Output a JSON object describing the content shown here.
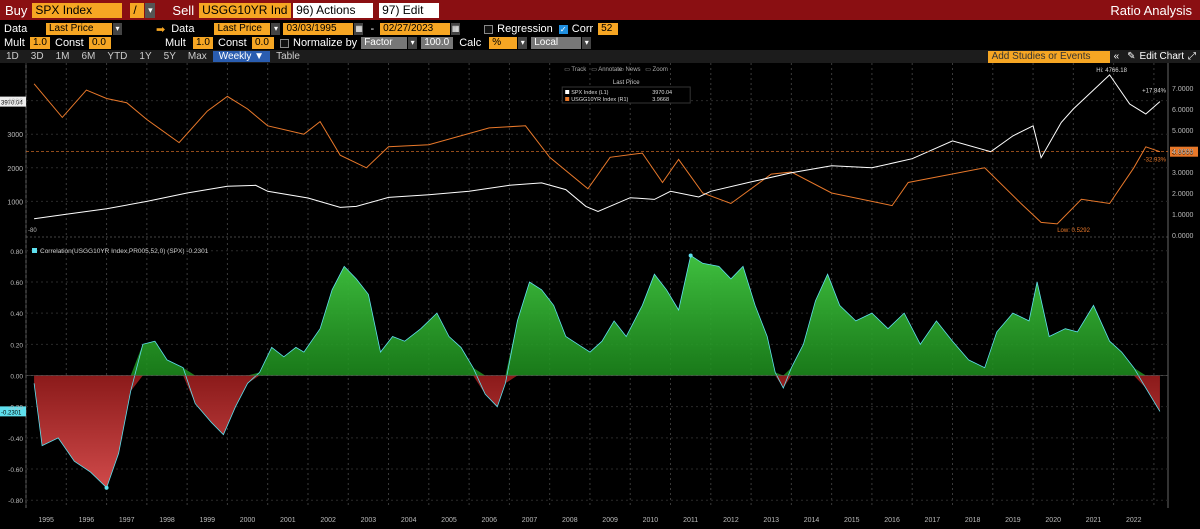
{
  "topbar": {
    "buy": "Buy",
    "security1": "SPX Index",
    "slash": "/",
    "sell": "Sell",
    "security2": "USGG10YR Ind",
    "actions": "96) Actions",
    "edit": "97) Edit",
    "title": "Ratio Analysis"
  },
  "row1": {
    "data_label": "Data",
    "data_value": "Last Price",
    "data2_label": "Data",
    "data2_value": "Last Price",
    "date_from": "03/03/1995",
    "dash": "-",
    "date_to": "02/27/2023",
    "regression": "Regression",
    "corr": "Corr",
    "corr_value": "52"
  },
  "row2": {
    "mult": "Mult",
    "mult_value": "1.0",
    "const": "Const",
    "const_value": "0.0",
    "mult2": "Mult",
    "mult2_value": "1.0",
    "const2": "Const",
    "const2_value": "0.0",
    "normalize": "Normalize by",
    "normalize_value": "Factor",
    "factor_value": "100.0",
    "calc": "Calc",
    "calc_value": "%",
    "ccy": "Local CCY"
  },
  "tabs": [
    "1D",
    "3D",
    "1M",
    "6M",
    "YTD",
    "1Y",
    "5Y",
    "Max",
    "Weekly ▼",
    "Table"
  ],
  "tab_active": 8,
  "toolbar": {
    "add_studies": "Add Studies or Events",
    "edit_chart": "Edit Chart"
  },
  "colors": {
    "spx": "#ffffff",
    "yield": "#e8782a",
    "corr_pos": "#1e8f1e",
    "corr_neg": "#8b1a1a",
    "corr_line": "#5fe0ee",
    "topbar": "#8a0f12",
    "accent": "#f6a623"
  },
  "chart_data": [
    {
      "type": "line",
      "legend": {
        "title": "Last Price",
        "items": [
          {
            "name": "SPX Index (L1)",
            "value": "3970.04"
          },
          {
            "name": "USGG10YR Index (R1)",
            "value": "3.9668"
          }
        ],
        "tools": [
          "Track",
          "Annotate",
          "News",
          "Zoom"
        ]
      },
      "x_years": [
        1995,
        1996,
        1997,
        1998,
        1999,
        2000,
        2001,
        2002,
        2003,
        2004,
        2005,
        2006,
        2007,
        2008,
        2009,
        2010,
        2011,
        2012,
        2013,
        2014,
        2015,
        2016,
        2017,
        2018,
        2019,
        2020,
        2021,
        2022,
        2023
      ],
      "left_axis": {
        "ticks": [
          "1000",
          "2000",
          "3000",
          "4000"
        ],
        "ylim": [
          0,
          5000
        ]
      },
      "right_axis": {
        "ticks": [
          "0.0000",
          "1.0000",
          "2.0000",
          "3.0000",
          "4.0000",
          "5.0000",
          "6.0000",
          "7.0000"
        ],
        "ylim": [
          0,
          8
        ]
      },
      "series": [
        {
          "name": "SPX Index",
          "axis": "left",
          "points": [
            [
              1995.2,
              485
            ],
            [
              1996,
              620
            ],
            [
              1997,
              780
            ],
            [
              1998,
              1000
            ],
            [
              1999,
              1250
            ],
            [
              2000,
              1450
            ],
            [
              2000.7,
              1480
            ],
            [
              2001,
              1300
            ],
            [
              2002,
              1100
            ],
            [
              2002.8,
              820
            ],
            [
              2003.2,
              850
            ],
            [
              2004,
              1120
            ],
            [
              2005,
              1200
            ],
            [
              2006,
              1300
            ],
            [
              2007,
              1480
            ],
            [
              2007.8,
              1550
            ],
            [
              2008.4,
              1350
            ],
            [
              2008.9,
              850
            ],
            [
              2009.2,
              700
            ],
            [
              2010,
              1110
            ],
            [
              2010.6,
              1060
            ],
            [
              2011,
              1300
            ],
            [
              2011.7,
              1130
            ],
            [
              2012,
              1300
            ],
            [
              2013,
              1580
            ],
            [
              2014,
              1850
            ],
            [
              2015,
              2060
            ],
            [
              2016,
              2000
            ],
            [
              2017,
              2270
            ],
            [
              2018,
              2800
            ],
            [
              2018.95,
              2480
            ],
            [
              2019.5,
              2950
            ],
            [
              2020,
              3250
            ],
            [
              2020.2,
              2300
            ],
            [
              2020.7,
              3350
            ],
            [
              2021,
              3750
            ],
            [
              2021.9,
              4766
            ],
            [
              2022.4,
              3900
            ],
            [
              2022.8,
              3600
            ],
            [
              2023.15,
              3970
            ]
          ]
        },
        {
          "name": "USGG10YR Index",
          "axis": "right",
          "points": [
            [
              1995.2,
              7.2
            ],
            [
              1995.9,
              5.6
            ],
            [
              1996.5,
              6.9
            ],
            [
              1997,
              6.5
            ],
            [
              1997.5,
              6.3
            ],
            [
              1998,
              5.5
            ],
            [
              1998.8,
              4.4
            ],
            [
              1999.5,
              5.9
            ],
            [
              2000,
              6.6
            ],
            [
              2000.5,
              6.0
            ],
            [
              2001,
              5.2
            ],
            [
              2001.9,
              4.8
            ],
            [
              2002.3,
              5.4
            ],
            [
              2002.8,
              3.8
            ],
            [
              2003.45,
              3.2
            ],
            [
              2004,
              4.2
            ],
            [
              2005,
              4.3
            ],
            [
              2006.5,
              5.1
            ],
            [
              2007.4,
              5.2
            ],
            [
              2008,
              3.7
            ],
            [
              2008.95,
              2.2
            ],
            [
              2009.5,
              3.7
            ],
            [
              2010.3,
              3.9
            ],
            [
              2010.8,
              2.5
            ],
            [
              2011.2,
              3.6
            ],
            [
              2011.8,
              2.0
            ],
            [
              2012.5,
              1.5
            ],
            [
              2013.5,
              2.9
            ],
            [
              2014,
              3.0
            ],
            [
              2015,
              2.0
            ],
            [
              2016.5,
              1.4
            ],
            [
              2016.9,
              2.5
            ],
            [
              2018.8,
              3.2
            ],
            [
              2019.7,
              1.5
            ],
            [
              2020.2,
              0.6
            ],
            [
              2020.6,
              0.53
            ],
            [
              2021.2,
              1.7
            ],
            [
              2021.9,
              1.5
            ],
            [
              2022.5,
              3.2
            ],
            [
              2022.8,
              4.2
            ],
            [
              2023.15,
              3.9668
            ]
          ]
        }
      ],
      "annotations": {
        "high": "Hi: 4766.18",
        "low": "Low: 0.5292",
        "spx_last": "3970.04",
        "yield_last": "3.9668",
        "spx_pct": "+17.84%",
        "yield_pct": "-32.93%",
        "bottom_tag": "-80"
      }
    },
    {
      "type": "area",
      "title": "Correlation(USGG10YR Index,PR005,52,0) (SPX) -0.2301",
      "last_value": "-0.2301",
      "y_ticks": [
        "-0.80",
        "-0.60",
        "-0.40",
        "-0.20",
        "0.00",
        "0.20",
        "0.40",
        "0.60",
        "0.80"
      ],
      "ylim": [
        -0.85,
        0.85
      ],
      "x_years": [
        1995,
        1996,
        1997,
        1998,
        1999,
        2000,
        2001,
        2002,
        2003,
        2004,
        2005,
        2006,
        2007,
        2008,
        2009,
        2010,
        2011,
        2012,
        2013,
        2014,
        2015,
        2016,
        2017,
        2018,
        2019,
        2020,
        2021,
        2022,
        2023
      ],
      "points": [
        [
          1995.2,
          -0.05
        ],
        [
          1995.4,
          -0.45
        ],
        [
          1995.8,
          -0.4
        ],
        [
          1996.2,
          -0.55
        ],
        [
          1996.6,
          -0.62
        ],
        [
          1997,
          -0.72
        ],
        [
          1997.3,
          -0.5
        ],
        [
          1997.6,
          -0.1
        ],
        [
          1997.9,
          0.2
        ],
        [
          1998.2,
          0.22
        ],
        [
          1998.5,
          0.1
        ],
        [
          1998.9,
          0.05
        ],
        [
          1999.2,
          -0.18
        ],
        [
          1999.6,
          -0.3
        ],
        [
          1999.9,
          -0.38
        ],
        [
          2000.2,
          -0.2
        ],
        [
          2000.5,
          -0.05
        ],
        [
          2000.8,
          0.02
        ],
        [
          2001.1,
          0.18
        ],
        [
          2001.4,
          0.12
        ],
        [
          2001.7,
          0.18
        ],
        [
          2001.9,
          0.15
        ],
        [
          2002.3,
          0.3
        ],
        [
          2002.6,
          0.55
        ],
        [
          2002.9,
          0.7
        ],
        [
          2003.2,
          0.62
        ],
        [
          2003.5,
          0.52
        ],
        [
          2003.8,
          0.15
        ],
        [
          2004.1,
          0.25
        ],
        [
          2004.4,
          0.22
        ],
        [
          2004.8,
          0.3
        ],
        [
          2005.2,
          0.4
        ],
        [
          2005.5,
          0.25
        ],
        [
          2005.8,
          0.18
        ],
        [
          2006.1,
          0.05
        ],
        [
          2006.4,
          -0.12
        ],
        [
          2006.7,
          -0.2
        ],
        [
          2006.9,
          -0.05
        ],
        [
          2007.2,
          0.35
        ],
        [
          2007.5,
          0.6
        ],
        [
          2007.8,
          0.55
        ],
        [
          2008.1,
          0.45
        ],
        [
          2008.4,
          0.25
        ],
        [
          2008.7,
          0.2
        ],
        [
          2009,
          0.15
        ],
        [
          2009.3,
          0.22
        ],
        [
          2009.6,
          0.35
        ],
        [
          2009.9,
          0.25
        ],
        [
          2010.3,
          0.45
        ],
        [
          2010.6,
          0.65
        ],
        [
          2010.9,
          0.55
        ],
        [
          2011.2,
          0.42
        ],
        [
          2011.5,
          0.77
        ],
        [
          2011.8,
          0.72
        ],
        [
          2012.2,
          0.7
        ],
        [
          2012.5,
          0.62
        ],
        [
          2012.8,
          0.7
        ],
        [
          2013.1,
          0.45
        ],
        [
          2013.4,
          0.25
        ],
        [
          2013.6,
          0.02
        ],
        [
          2013.8,
          -0.08
        ],
        [
          2014,
          0.05
        ],
        [
          2014.3,
          0.2
        ],
        [
          2014.6,
          0.48
        ],
        [
          2014.9,
          0.65
        ],
        [
          2015.2,
          0.45
        ],
        [
          2015.6,
          0.35
        ],
        [
          2016,
          0.4
        ],
        [
          2016.4,
          0.3
        ],
        [
          2016.8,
          0.4
        ],
        [
          2017.2,
          0.2
        ],
        [
          2017.6,
          0.35
        ],
        [
          2018,
          0.22
        ],
        [
          2018.4,
          0.1
        ],
        [
          2018.8,
          0.05
        ],
        [
          2019.1,
          0.28
        ],
        [
          2019.5,
          0.4
        ],
        [
          2019.9,
          0.35
        ],
        [
          2020.1,
          0.6
        ],
        [
          2020.4,
          0.25
        ],
        [
          2020.8,
          0.3
        ],
        [
          2021.1,
          0.28
        ],
        [
          2021.5,
          0.45
        ],
        [
          2021.9,
          0.22
        ],
        [
          2022.2,
          0.15
        ],
        [
          2022.5,
          0.05
        ],
        [
          2022.8,
          -0.08
        ],
        [
          2023.15,
          -0.2301
        ]
      ]
    }
  ]
}
